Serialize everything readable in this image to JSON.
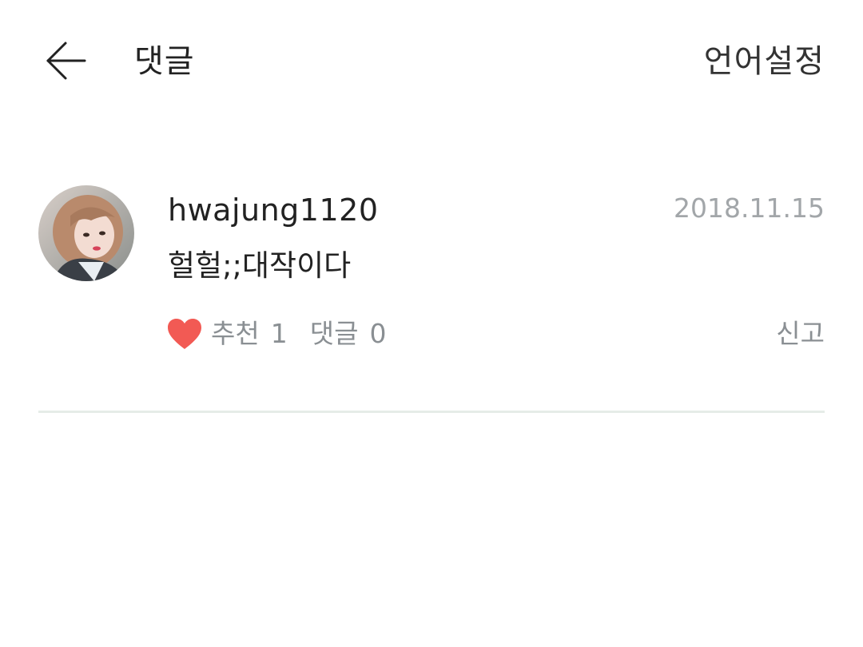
{
  "header": {
    "back_icon": "arrow-left-icon",
    "title": "댓글",
    "language_settings_label": "언어설정"
  },
  "comment": {
    "avatar_icon": "user-avatar-photo",
    "username": "hwajung1120",
    "date": "2018.11.15",
    "text": "헐헐;;대작이다",
    "like_icon": "heart-icon",
    "like_label": "추천",
    "like_count": "1",
    "reply_label": "댓글",
    "reply_count": "0",
    "report_label": "신고"
  },
  "colors": {
    "heart": "#f25a54",
    "meta_text": "#8a8f93",
    "date_text": "#a2a6a9",
    "divider": "#e6ece8"
  }
}
